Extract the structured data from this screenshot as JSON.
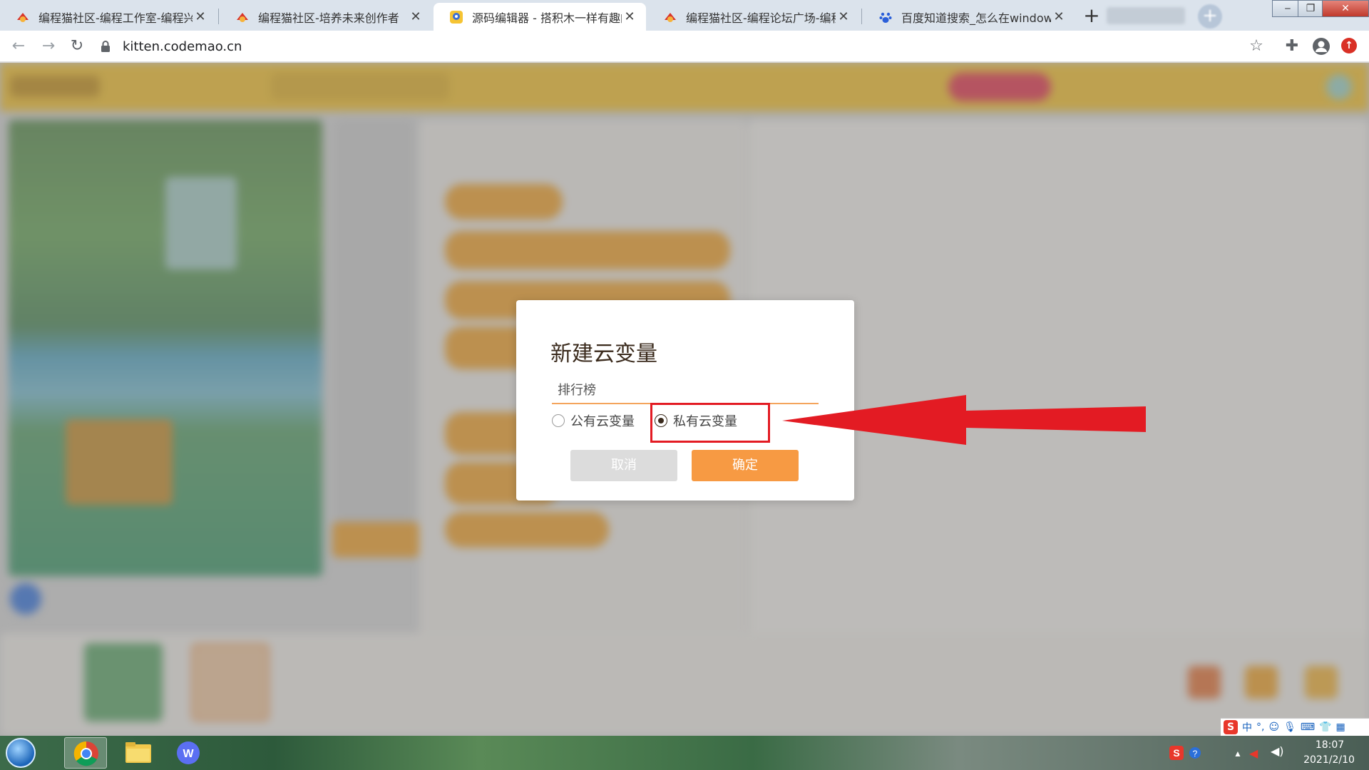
{
  "browser": {
    "tabs": [
      {
        "title": "编程猫社区-编程工作室-编程兴趣",
        "active": false
      },
      {
        "title": "编程猫社区-培养未来创作者",
        "active": false
      },
      {
        "title": "源码编辑器 - 搭积木一样有趣的编",
        "active": true
      },
      {
        "title": "编程猫社区-编程论坛广场-编程学",
        "active": false
      },
      {
        "title": "百度知道搜索_怎么在windows电",
        "active": false
      }
    ],
    "new_tab_label": "+",
    "url": "kitten.codemao.cn"
  },
  "dialog": {
    "title": "新建云变量",
    "variable_name_value": "排行榜",
    "options": [
      {
        "label": "公有云变量",
        "checked": false
      },
      {
        "label": "私有云变量",
        "checked": true
      }
    ],
    "cancel_label": "取消",
    "confirm_label": "确定"
  },
  "annotation": {
    "color": "#e31b23"
  },
  "taskbar": {
    "time": "18:07",
    "date": "2021/2/10",
    "ime_label": "中"
  },
  "colors": {
    "app_header": "#f7c430",
    "confirm_button": "#f79a43",
    "cancel_button": "#dcdcdc",
    "input_underline": "#f4a45c"
  }
}
